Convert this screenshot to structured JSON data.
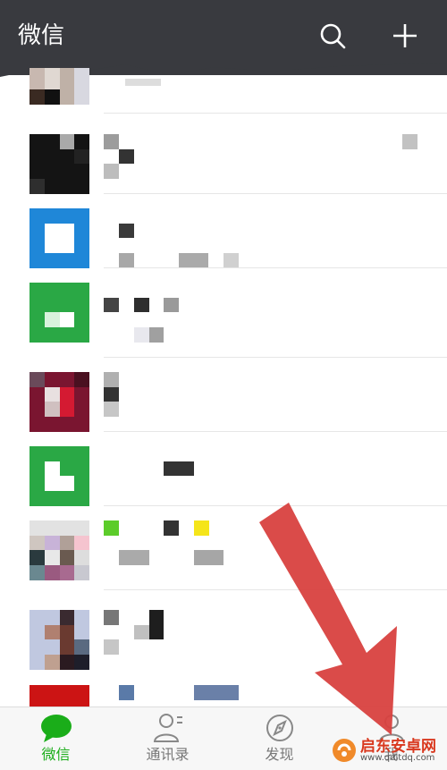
{
  "header": {
    "title": "微信",
    "search_icon": "search-icon",
    "add_icon": "plus-icon"
  },
  "tabs": [
    {
      "label": "微信",
      "icon": "chat-bubble-icon",
      "active": true
    },
    {
      "label": "通讯录",
      "icon": "contacts-icon",
      "active": false
    },
    {
      "label": "发现",
      "icon": "compass-icon",
      "active": false
    },
    {
      "label": "我",
      "icon": "person-icon",
      "active": false
    }
  ],
  "colors": {
    "header_bg": "#393a3f",
    "active_green": "#1aad19",
    "arrow_red": "#d8413f"
  },
  "watermark": {
    "text": "启东安卓网",
    "url": "www.qdltdq.com"
  }
}
